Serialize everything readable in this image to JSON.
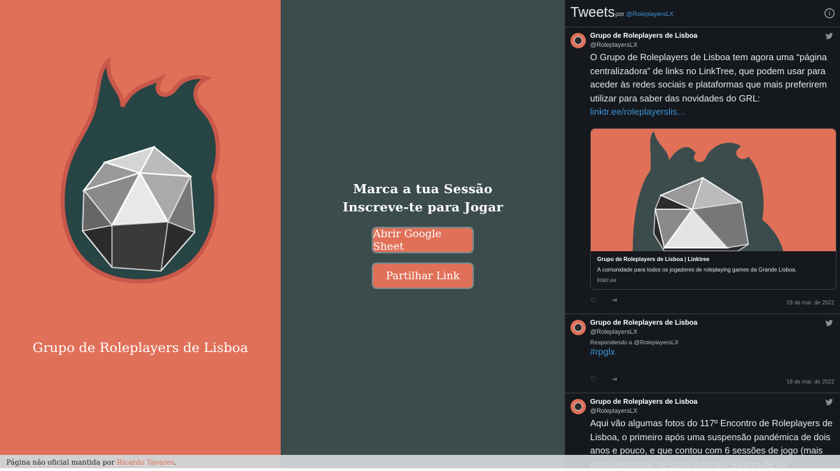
{
  "left": {
    "site_title": "Grupo de Roleplayers de Lisboa"
  },
  "middle": {
    "line1": "Marca a tua Sessão",
    "line2": "Inscreve-te para Jogar",
    "button1": "Abrir Google Sheet",
    "button2": "Partilhar Link"
  },
  "twitter": {
    "header": {
      "title": "Tweets",
      "por": "por",
      "handle": "@RoleplayersLX"
    },
    "tweets": [
      {
        "name": "Grupo de Roleplayers de Lisboa",
        "handle": "@RoleplayersLX",
        "text": "O Grupo de Roleplayers de Lisboa tem agora uma “página centralizadora” de links no LinkTree, que podem usar para aceder às redes sociais e plataformas que mais preferirem utilizar para saber das novidades do GRL:",
        "link": "linktr.ee/roleplayerslis…",
        "card_title": "Grupo de Roleplayers de Lisboa | Linktree",
        "card_desc": "A comunidade para todos os jogadores de roleplaying games da Grande Lisboa.",
        "card_domain": "linktr.ee",
        "date": "19 de mai. de 2022"
      },
      {
        "name": "Grupo de Roleplayers de Lisboa",
        "handle": "@RoleplayersLX",
        "reply": "Respondendo a @RoleplayersLX",
        "text": "#rpglx",
        "date": "18 de mai. de 2022"
      },
      {
        "name": "Grupo de Roleplayers de Lisboa",
        "handle": "@RoleplayersLX",
        "text": "Aqui vão algumas fotos do 117º Encontro de Roleplayers de Lisboa, o primeiro após uma suspensão pandémica de dois anos e pouco, e que contou com 6 sessões de jogo (mais duas pequenas, de curta duração) e cerca de 45"
      }
    ]
  },
  "footer": {
    "prefix": "Página não oficial mantida por ",
    "author": "Ricardo Tavares",
    "suffix": "."
  },
  "colors": {
    "coral": "#e07058",
    "slate": "#3c4c4c",
    "dark": "#15181c",
    "link": "#3b94d9"
  }
}
